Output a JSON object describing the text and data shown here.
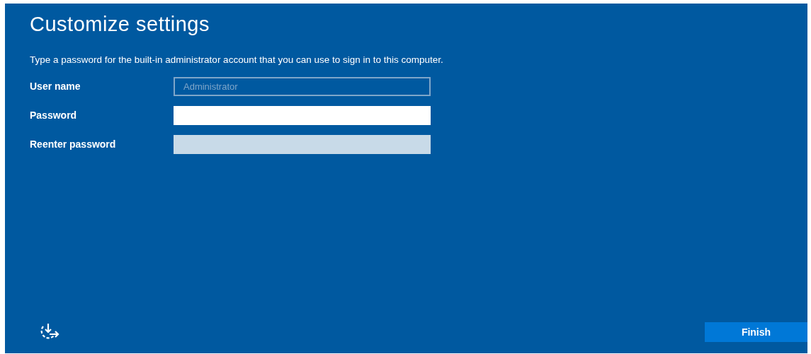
{
  "title": "Customize settings",
  "instruction": "Type a password for the built-in administrator account that you can use to sign in to this computer.",
  "fields": [
    {
      "label": "User name",
      "kind": "text",
      "value": "Administrator",
      "disabled": true
    },
    {
      "label": "Password",
      "kind": "password",
      "disabled": false
    },
    {
      "label": "Reenter password",
      "kind": "password",
      "disabled": true
    }
  ],
  "buttons": [
    {
      "label": "Finish"
    }
  ]
}
